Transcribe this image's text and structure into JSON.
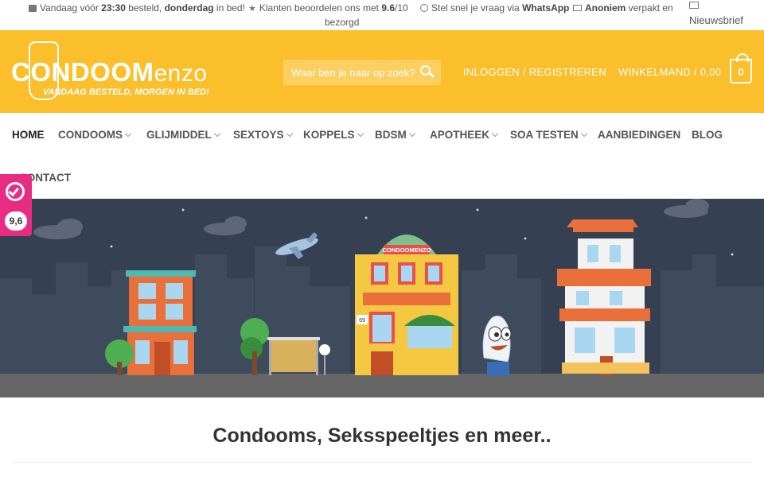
{
  "topbar": {
    "item1_a": "Vandaag vóór ",
    "item1_b": "23:30",
    "item1_c": " besteld, ",
    "item1_d": "donderdag",
    "item1_e": " in bed!",
    "item2_a": "Klanten beoordelen ons met ",
    "item2_b": "9.6",
    "item2_c": "/10",
    "item3_a": "Stel snel je vraag via ",
    "item3_b": "WhatsApp",
    "item4_a": "Anoniem",
    "item4_b": " verpakt en",
    "item4_c": "bezorgd",
    "newsletter": "Nieuwsbrief"
  },
  "header": {
    "logo_main": "CONDOOM",
    "logo_suffix": "enzo",
    "logo_tagline": "VANDAAG BESTELD, MORGEN IN BED!",
    "search_placeholder": "Waar ben je naar op zoek?",
    "login": "INLOGGEN / REGISTREREN",
    "cart": "WINKELMAND / 0,00",
    "cart_count": "0",
    "accent": "#fbbf2c"
  },
  "nav": {
    "items": [
      {
        "label": "HOME",
        "dropdown": false
      },
      {
        "label": "CONDOOMS",
        "dropdown": true
      },
      {
        "label": "GLIJMIDDEL",
        "dropdown": true
      },
      {
        "label": "SEXTOYS",
        "dropdown": true
      },
      {
        "label": "KOPPELS",
        "dropdown": true
      },
      {
        "label": "BDSM",
        "dropdown": true
      },
      {
        "label": "APOTHEEK",
        "dropdown": true
      },
      {
        "label": "SOA TESTEN",
        "dropdown": true
      },
      {
        "label": "AANBIEDINGEN",
        "dropdown": false
      },
      {
        "label": "BLOG",
        "dropdown": false
      },
      {
        "label": "CONTACT",
        "dropdown": false
      }
    ]
  },
  "rating": {
    "score": "9,6",
    "color": "#e82c84"
  },
  "hero": {
    "shop_sign": "CONDOOMENZO",
    "house_number": "69"
  },
  "main": {
    "heading": "Condooms, Seksspeeltjes en meer.."
  }
}
